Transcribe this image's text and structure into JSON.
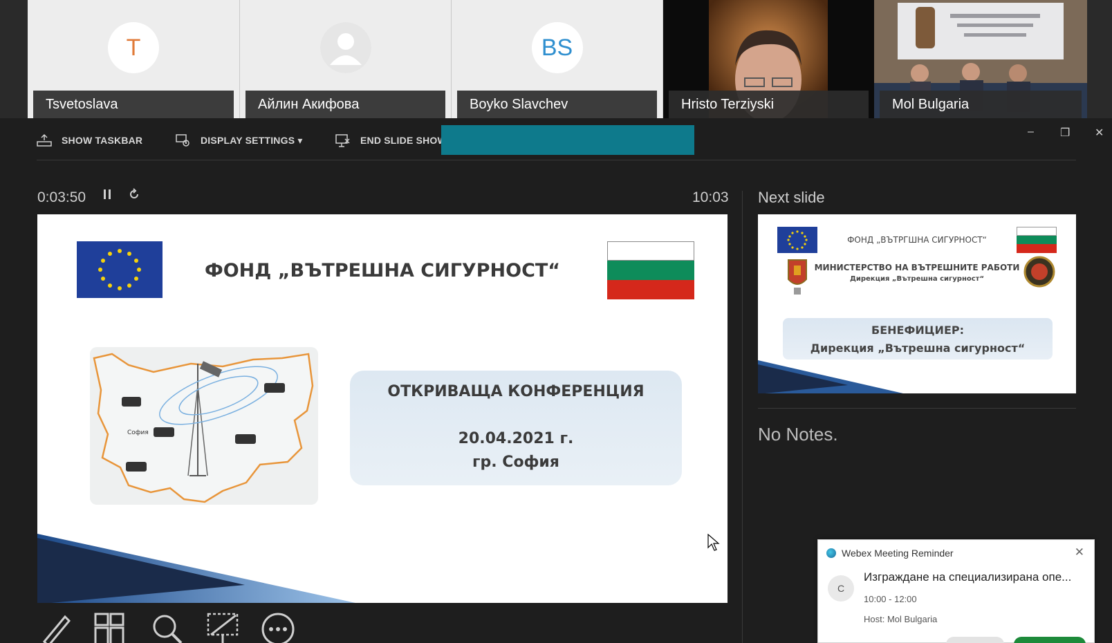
{
  "participants": [
    {
      "name": "Tsvetoslava",
      "initials": "T",
      "initials_color": "#e07b39",
      "type": "initials"
    },
    {
      "name": "Айлин Акифова",
      "initials": "",
      "type": "placeholder"
    },
    {
      "name": "Boyko Slavchev",
      "initials": "BS",
      "initials_color": "#2f8fcf",
      "type": "initials"
    },
    {
      "name": "Hristo Terziyski",
      "initials": "",
      "type": "video"
    },
    {
      "name": "Mol Bulgaria",
      "initials": "",
      "type": "video"
    }
  ],
  "toolbar": {
    "show_taskbar": "SHOW TASKBAR",
    "display_settings": "DISPLAY SETTINGS ▾",
    "end_slide_show": "END SLIDE SHOW"
  },
  "window_controls": {
    "minimize": "–",
    "restore": "❐",
    "close": "✕"
  },
  "presenter": {
    "elapsed": "0:03:50",
    "clock": "10:03",
    "next_slide_label": "Next slide",
    "notes": "No Notes."
  },
  "current_slide": {
    "fund_title": "ФОНД „ВЪТРЕШНА СИГУРНОСТ“",
    "map_label": "София",
    "conference_title": "ОТКРИВАЩА КОНФЕРЕНЦИЯ",
    "date": "20.04.2021 г.",
    "city": "гр. София"
  },
  "next_slide": {
    "fund_title": "ФОНД „ВЪТРГШНА СИГУРНОСТ“",
    "ministry": "МИНИСТЕРСТВО НА ВЪТРЕШНИТЕ РАБОТИ",
    "directorate": "Дирекция „Вътрешна сигурност“",
    "beneficiary_label": "БЕНЕФИЦИЕР:",
    "beneficiary_name": "Дирекция „Вътрешна сигурност“"
  },
  "reminder": {
    "app": "Webex Meeting Reminder",
    "avatar_initial": "C",
    "meeting_title": "Изграждане на специализирана опе...",
    "time": "10:00 - 12:00",
    "host": "Host: Mol Bulgaria"
  },
  "colors": {
    "accent_cover": "#0e7a8c",
    "eu_blue": "#1f3f9a",
    "eu_gold": "#f5d20c",
    "bg_white": "#ffffff",
    "bg_green": "#0e8c5a",
    "bg_red": "#d5281b",
    "map_outline": "#e8953a"
  }
}
